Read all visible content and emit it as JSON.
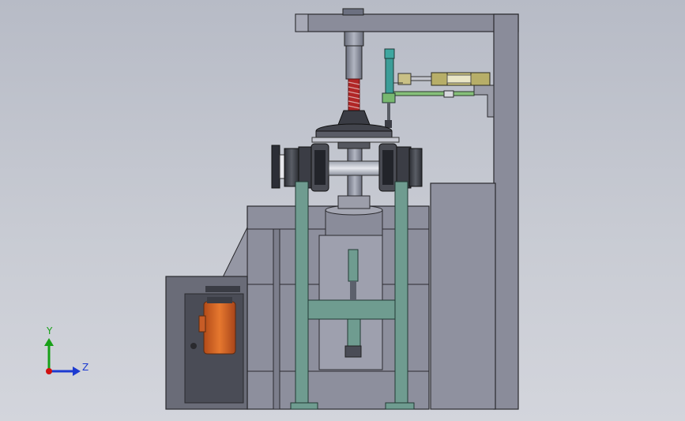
{
  "viewport": {
    "background_top": "#b7bbc6",
    "background_bottom": "#d3d5dc"
  },
  "model": {
    "frame_color": "#8c8e9c",
    "column_color": "#6e9a8e",
    "motor_color": "#d8642a",
    "cylinder_color": "#c9c27a",
    "sensor_color": "#3fa6a0"
  },
  "triad": {
    "y_label": "Y",
    "z_label": "Z",
    "y_color": "#18a018",
    "z_color": "#1c3ad0",
    "origin_color": "#d01010"
  }
}
